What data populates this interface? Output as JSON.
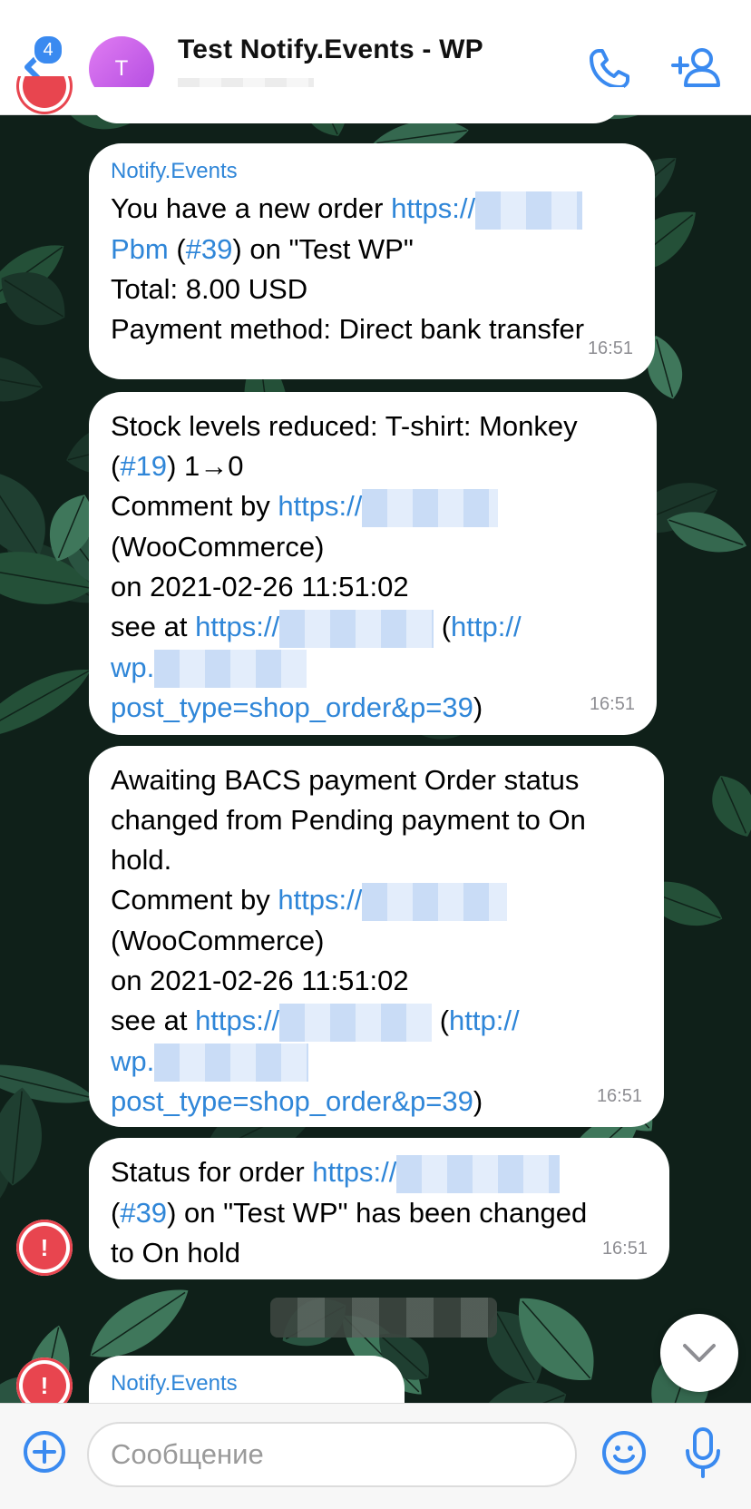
{
  "header": {
    "unread_count": "4",
    "avatar_letter": "T",
    "title": "Test Notify.Events - WP",
    "subtitle": "",
    "icons": [
      "chevron-left-icon",
      "phone-icon",
      "add-user-icon"
    ]
  },
  "colors": {
    "accent": "#2f86d8",
    "badge": "#3a8af0",
    "avatar_gradient": [
      "#e07cf2",
      "#b14ae0"
    ],
    "alert_red": "#e8454f"
  },
  "messages": [
    {
      "sender": "Notify.Events",
      "line1_text": "You have a new order ",
      "line1_link": "https://",
      "line2_link_a": "Pbm",
      "line2_paren_open": " (",
      "line2_link_b": "#39",
      "line2_rest": ") on \"Test WP\"",
      "line3": "Total: 8.00 USD",
      "line4": "Payment method: Direct bank transfer",
      "time": "16:51"
    },
    {
      "line1": "Stock levels reduced: T-shirt: Monkey",
      "line2_open": "(",
      "line2_link": "#19",
      "line2_rest": ") 1→0",
      "line3_text": "Comment by ",
      "line3_link": "https://",
      "line4": "(WooCommerce)",
      "line5": "on 2021-02-26 11:51:02",
      "line6_text": "see at ",
      "line6_link_a": "https://",
      "line6_mid": " (",
      "line6_link_b": "http://",
      "line7_link": "wp.",
      "line8_link": "post_type=shop_order&p=39",
      "line8_close": ")",
      "time": "16:51"
    },
    {
      "line1": "Awaiting BACS payment Order status",
      "line2": "changed from Pending payment to On",
      "line3": "hold.",
      "line4_text": "Comment by ",
      "line4_link": "https://",
      "line5": "(WooCommerce)",
      "line6": "on 2021-02-26 11:51:02",
      "line7_text": "see at ",
      "line7_link_a": "https://",
      "line7_mid": " (",
      "line7_link_b": "http://",
      "line8_link": "wp.",
      "line9_link": "post_type=shop_order&p=39",
      "line9_close": ")",
      "time": "16:51"
    },
    {
      "line1_text": "Status for order ",
      "line1_link": "https://",
      "line2_open": "(",
      "line2_link": "#39",
      "line2_rest": ") on \"Test WP\" has been changed",
      "line3": "to On hold",
      "time": "16:51"
    },
    {
      "sender": "Notify.Events"
    }
  ],
  "alert_avatar_glyph": "!",
  "input": {
    "placeholder": "Сообщение",
    "value": ""
  }
}
